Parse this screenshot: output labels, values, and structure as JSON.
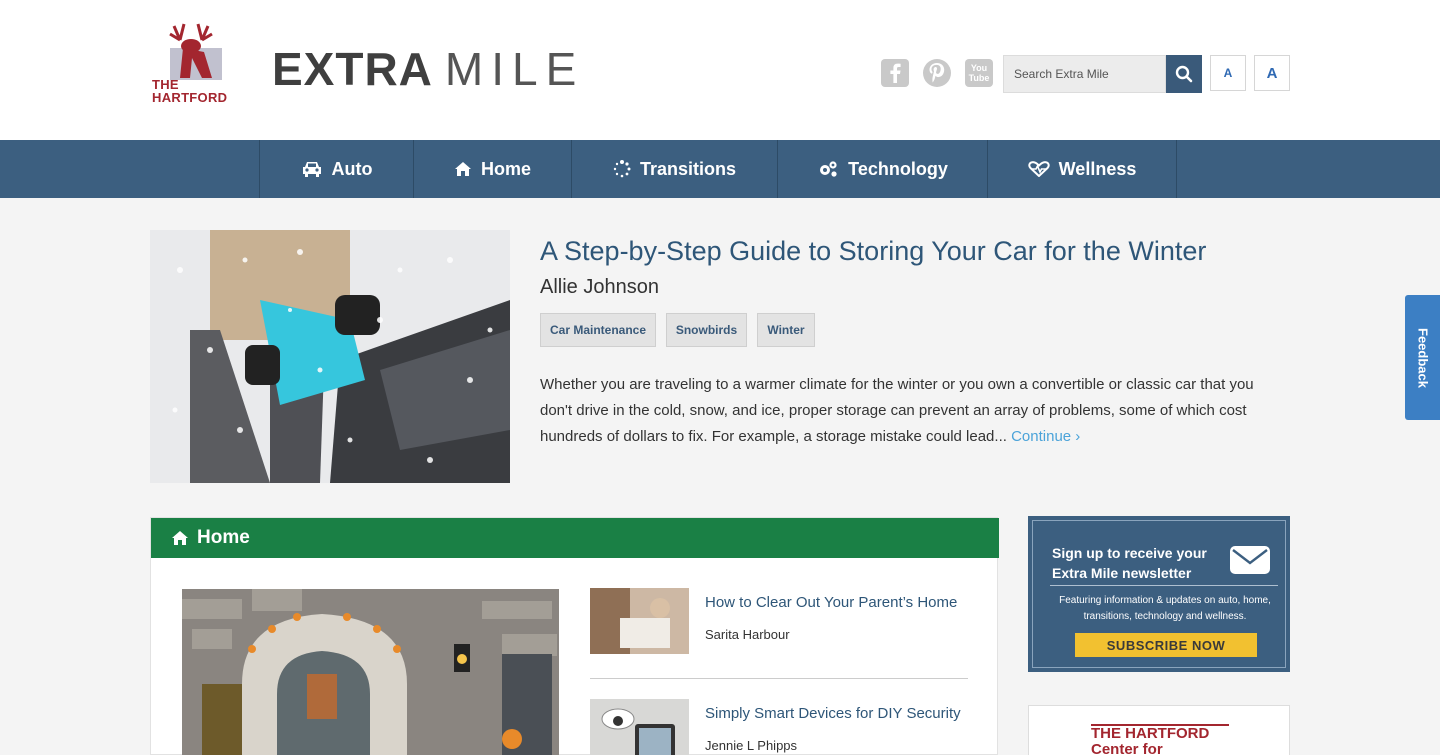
{
  "header": {
    "logo_text_line1": "THE",
    "logo_text_line2": "HARTFORD",
    "brand_bold": "EXTRA",
    "brand_light": "MILE",
    "search_placeholder": "Search Extra Mile",
    "font_small": "A",
    "font_large": "A",
    "social": [
      "facebook-icon",
      "pinterest-icon",
      "youtube-icon"
    ],
    "youtube_text_top": "You",
    "youtube_text_bottom": "Tube"
  },
  "nav": {
    "items": [
      {
        "label": "Auto",
        "icon": "car-icon"
      },
      {
        "label": "Home",
        "icon": "house-icon"
      },
      {
        "label": "Transitions",
        "icon": "spinner-icon"
      },
      {
        "label": "Technology",
        "icon": "gears-icon"
      },
      {
        "label": "Wellness",
        "icon": "heartbeat-icon"
      }
    ]
  },
  "featured": {
    "title": "A Step-by-Step Guide to Storing Your Car for the Winter",
    "author": "Allie Johnson",
    "tags": [
      "Car Maintenance",
      "Snowbirds",
      "Winter"
    ],
    "body": "Whether you are traveling to a warmer climate for the winter or you own a convertible or classic car that you don't drive in the cold, snow, and ice, proper storage can prevent an array of problems, some of which cost hundreds of dollars to fix. For example, a storage mistake could lead... ",
    "continue_label": "Continue ›"
  },
  "feedback_label": "Feedback",
  "home_section": {
    "title": "Home",
    "items": [
      {
        "title": "How to Clear Out Your Parent’s Home",
        "author": "Sarita Harbour"
      },
      {
        "title": "Simply Smart Devices for DIY Security",
        "author": "Jennie L Phipps"
      }
    ]
  },
  "newsletter": {
    "title": "Sign up to receive your Extra Mile newsletter",
    "description": "Featuring information & updates on auto, home, transitions, technology and wellness.",
    "button": "SUBSCRIBE NOW"
  },
  "center": {
    "line1": "THE HARTFORD",
    "line2": "Center for"
  },
  "colors": {
    "nav_bg": "#3c5f80",
    "home_green": "#1a8045",
    "title_blue": "#2e5678",
    "hartford_red": "#a3262f",
    "subscribe_yellow": "#f2c130"
  }
}
